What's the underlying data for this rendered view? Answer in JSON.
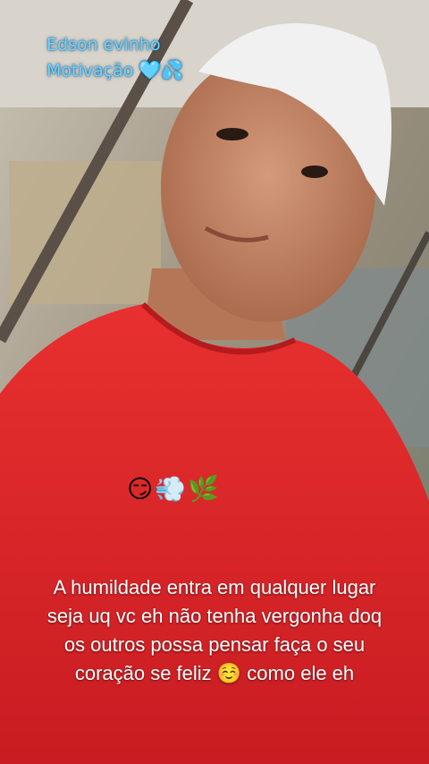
{
  "overlay": {
    "name_line": "Edson evinho",
    "motivation_line": "Motivação",
    "motivation_emojis": "🩵💦"
  },
  "emoji_row": "😏💨🌿",
  "caption": {
    "line1": "A humildade entra em qualquer lugar",
    "line2": "seja uq vc eh não tenha vergonha doq",
    "line3": "os outros possa pensar  faça o seu",
    "line4": "coração se feliz ☺️  como ele eh"
  },
  "colors": {
    "shirt": "#e0262a",
    "cap": "#f1f1f1",
    "overlay_text": "#6fd3ff"
  }
}
